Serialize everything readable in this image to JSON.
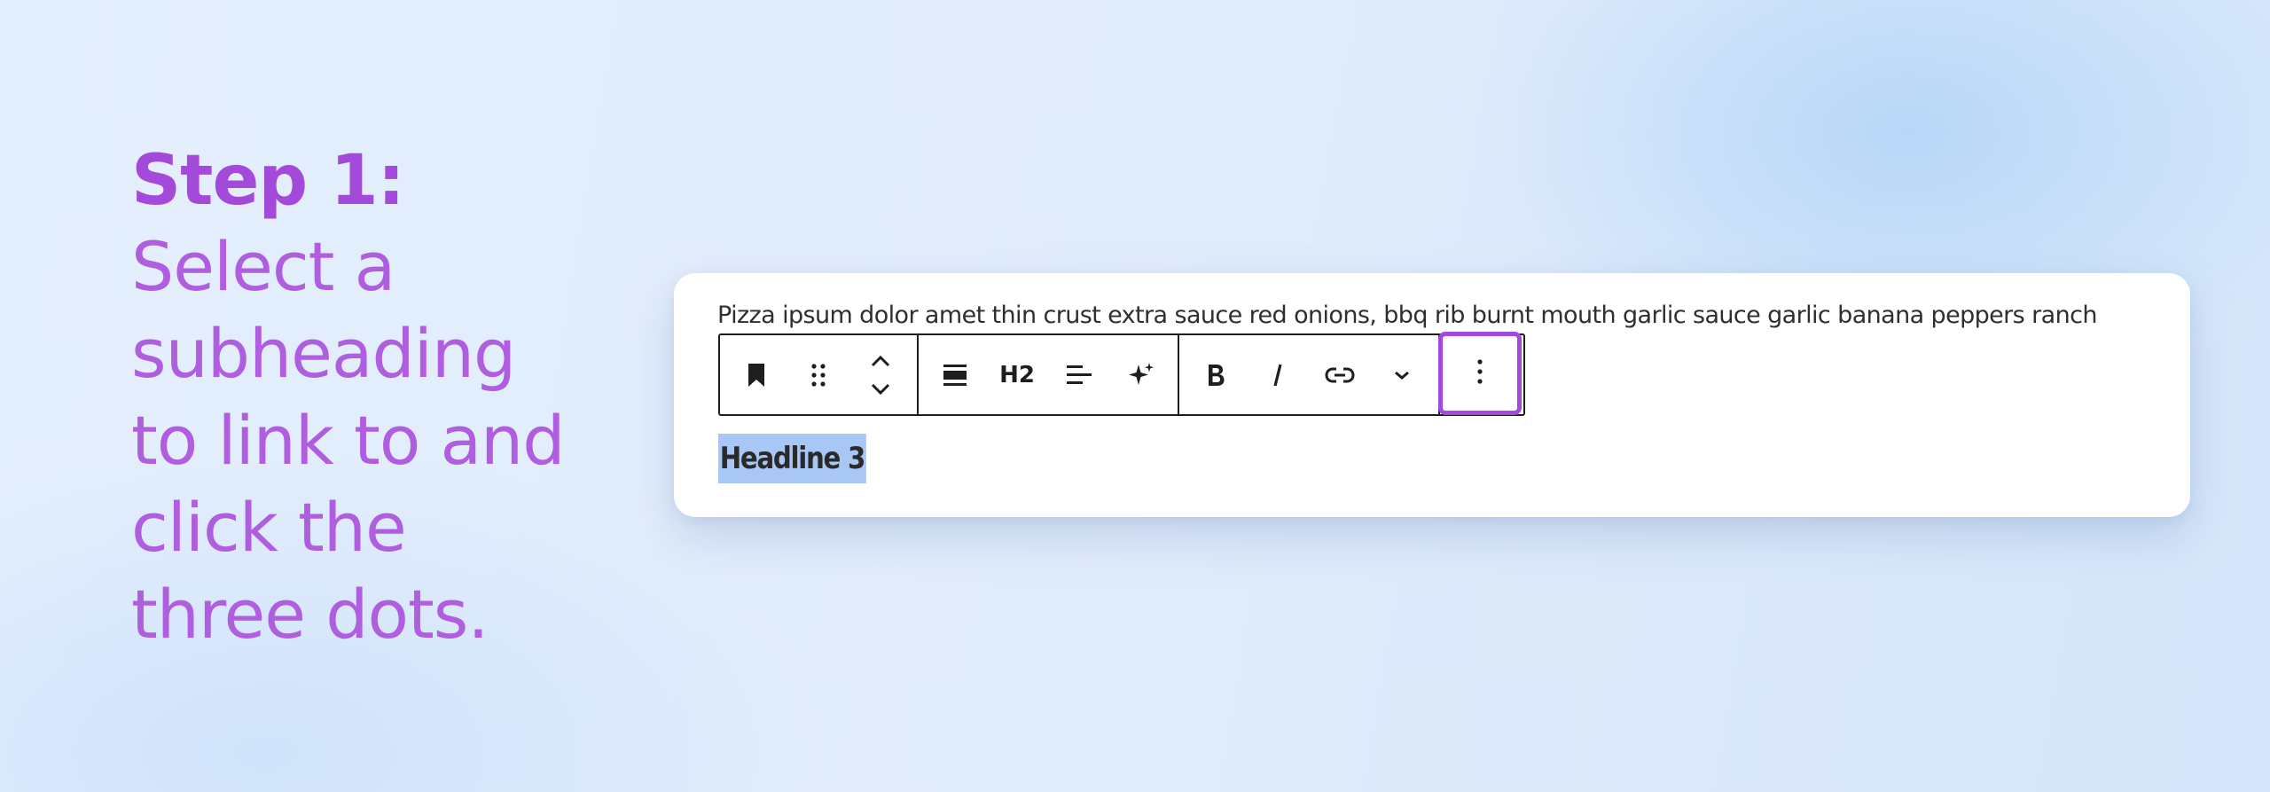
{
  "instruction": {
    "title": "Step 1:",
    "lines": [
      "Select a",
      "subheading",
      "to link to and",
      "click the",
      "three dots."
    ]
  },
  "editor": {
    "paragraph_text": "Pizza ipsum dolor amet thin crust extra sauce red onions, bbq rib burnt mouth garlic sauce garlic banana peppers ranch",
    "toolbar": {
      "heading_level_label": "H2",
      "icons": {
        "block_type": "bookmark-icon",
        "drag": "drag-handle-icon",
        "move": "move-up-down-icon",
        "align": "align-wide-icon",
        "text_align": "align-left-icon",
        "ai": "sparkle-icon",
        "bold": "bold-icon",
        "italic": "italic-icon",
        "link": "link-icon",
        "more": "chevron-down-icon",
        "options": "vertical-dots-icon"
      }
    },
    "headline_text": "Headline 3"
  },
  "colors": {
    "accent": "#a44adb",
    "selection": "#a9c7f4",
    "toolbar_border": "#1e1e1e"
  }
}
